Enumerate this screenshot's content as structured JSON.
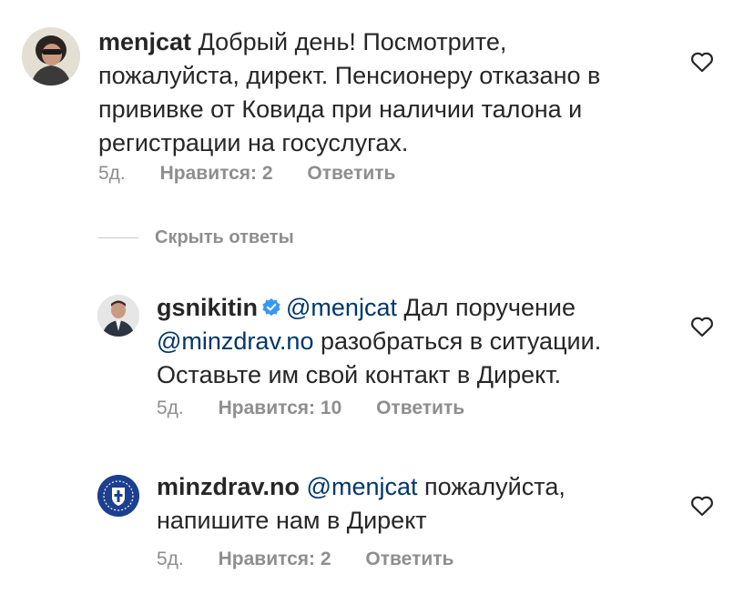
{
  "comments": [
    {
      "username": "menjcat",
      "text_lines": [
        "Добрый день! Посмотрите,",
        "пожалуйста, директ. Пенсионеру отказано в",
        "прививке от Ковида при наличии талона и",
        "регистрации на госуслугах."
      ],
      "time": "5д.",
      "likes": "Нравится: 2",
      "reply": "Ответить"
    },
    {
      "username": "gsnikitin",
      "verified": true,
      "mention": "@menjcat",
      "line1_text": "Дал поручение",
      "mention2": "@minzdrav.no",
      "line2_text": "разобраться в ситуации.",
      "line3_text": "Оставьте им свой контакт в Директ.",
      "time": "5д.",
      "likes": "Нравится: 10",
      "reply": "Ответить"
    },
    {
      "username": "minzdrav.no",
      "mention": "@menjcat",
      "line1_text": "пожалуйста,",
      "line2_text": "напишите нам в Директ",
      "time": "5д.",
      "likes": "Нравится: 2",
      "reply": "Ответить"
    }
  ],
  "hide_replies_label": "Скрыть ответы",
  "colors": {
    "text": "#262626",
    "secondary": "#8e8e8e",
    "mention": "#00376b",
    "verified": "#3897f0",
    "minzdrav_avatar": "#1c3f8f"
  },
  "icons": {
    "like": "heart-outline-icon",
    "verified": "verified-badge-icon"
  }
}
